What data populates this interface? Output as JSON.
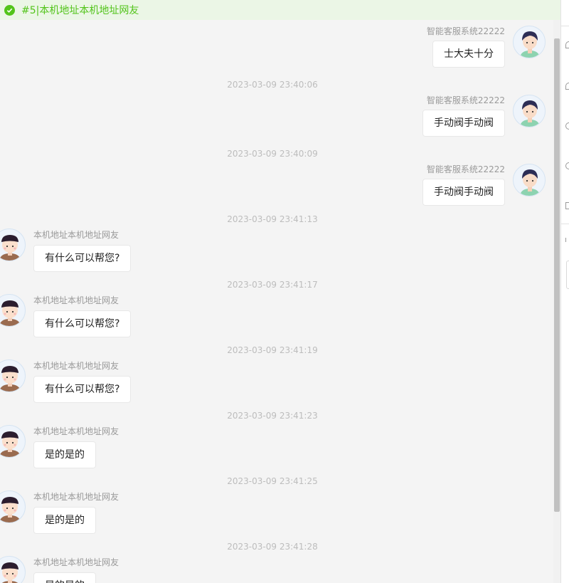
{
  "header": {
    "title": "#5|本机地址本机地址网友",
    "status_icon": "check-circle-icon",
    "accent": "#52c41a"
  },
  "messages": [
    {
      "side": "right",
      "sender": "智能客服系统22222",
      "text": "士大夫十分"
    },
    {
      "time": "2023-03-09 23:40:06",
      "side": "right",
      "sender": "智能客服系统22222",
      "text": "手动阀手动阀"
    },
    {
      "time": "2023-03-09 23:40:09",
      "side": "right",
      "sender": "智能客服系统22222",
      "text": "手动阀手动阀"
    },
    {
      "time": "2023-03-09 23:41:13",
      "side": "left",
      "sender": "本机地址本机地址网友",
      "text": "有什么可以帮您?"
    },
    {
      "time": "2023-03-09 23:41:17",
      "side": "left",
      "sender": "本机地址本机地址网友",
      "text": "有什么可以帮您?"
    },
    {
      "time": "2023-03-09 23:41:19",
      "side": "left",
      "sender": "本机地址本机地址网友",
      "text": "有什么可以帮您?"
    },
    {
      "time": "2023-03-09 23:41:23",
      "side": "left",
      "sender": "本机地址本机地址网友",
      "text": "是的是的"
    },
    {
      "time": "2023-03-09 23:41:25",
      "side": "left",
      "sender": "本机地址本机地址网友",
      "text": "是的是的"
    },
    {
      "time": "2023-03-09 23:41:28",
      "side": "left",
      "sender": "本机地址本机地址网友",
      "text": "是的是的"
    }
  ],
  "sidebar_icons": [
    "user-icon",
    "user-icon",
    "clock-icon",
    "clock-icon",
    "shop-icon"
  ]
}
